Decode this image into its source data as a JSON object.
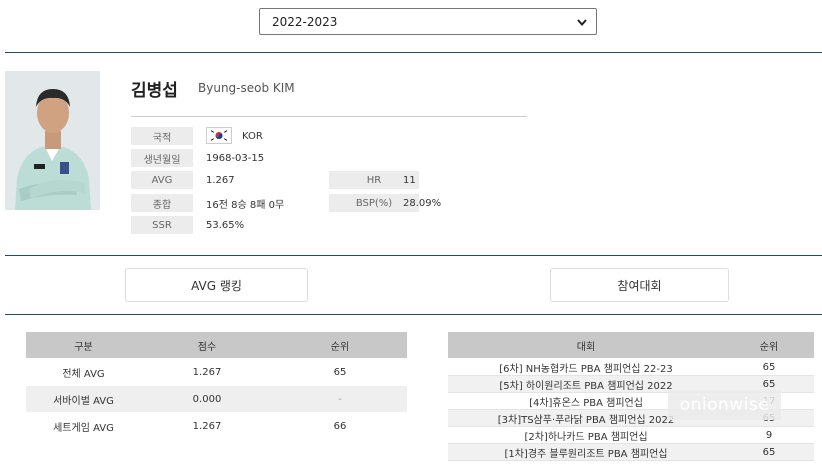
{
  "season": {
    "selected": "2022-2023"
  },
  "player": {
    "name_ko": "김병섭",
    "name_en": "Byung-seob KIM",
    "labels": {
      "nationality": "국적",
      "birth": "생년월일",
      "avg": "AVG",
      "record": "종합",
      "ssr": "SSR",
      "hr": "HR",
      "bsp": "BSP(%)"
    },
    "values": {
      "nationality": "KOR",
      "birth": "1968-03-15",
      "avg": "1.267",
      "record": "16전 8승 8패 0무",
      "ssr": "53.65%",
      "hr": "11",
      "bsp": "28.09%"
    }
  },
  "buttons": {
    "avg_ranking": "AVG 랭킹",
    "tournaments": "참여대회"
  },
  "avg_table": {
    "headers": [
      "구분",
      "점수",
      "순위"
    ],
    "rows": [
      {
        "type": "전체 AVG",
        "score": "1.267",
        "rank": "65"
      },
      {
        "type": "서바이벌 AVG",
        "score": "0.000",
        "rank": "-"
      },
      {
        "type": "세트게임 AVG",
        "score": "1.267",
        "rank": "66"
      }
    ]
  },
  "tournament_table": {
    "headers": [
      "대회",
      "순위"
    ],
    "rows": [
      {
        "name": "[6차] NH농협카드 PBA 챔피언십 22-23",
        "rank": "65"
      },
      {
        "name": "[5차] 하이원리조트 PBA 챔피언십 2022",
        "rank": "65"
      },
      {
        "name": "[4차]휴온스 PBA 챔피언십",
        "rank": "17"
      },
      {
        "name": "[3차]TS샴푸·푸라닭 PBA 챔피언십 2022",
        "rank": "65"
      },
      {
        "name": "[2차]하나카드 PBA 챔피언십",
        "rank": "9"
      },
      {
        "name": "[1차]경주 블루원리조트 PBA 챔피언십",
        "rank": "65"
      }
    ]
  },
  "watermark": "onionwise",
  "colors": {
    "divider": "#1f4e5a",
    "header_bg": "#c8c8c8",
    "label_bg": "#ececec"
  },
  "icons": [
    "chevron-down-icon",
    "korea-flag-icon"
  ]
}
